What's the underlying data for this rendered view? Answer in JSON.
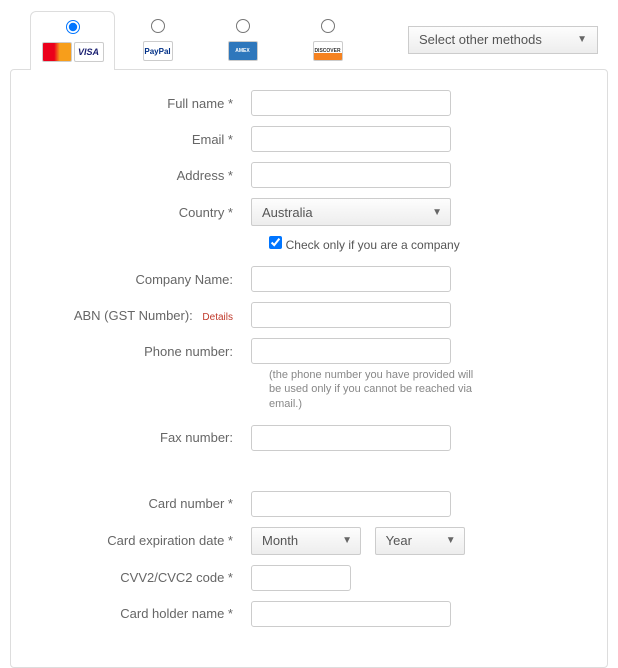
{
  "tabs": {
    "otherLabel": "Select other methods"
  },
  "labels": {
    "fullName": "Full name *",
    "email": "Email *",
    "address": "Address *",
    "country": "Country *",
    "companyCheck": "Check only if you are a company",
    "companyName": "Company Name:",
    "abn": "ABN (GST Number):",
    "details": "Details",
    "phone": "Phone number:",
    "phoneNote": "(the phone number you have provided will be used only if you cannot be reached via email.)",
    "fax": "Fax number:",
    "cardNumber": "Card number *",
    "cardExp": "Card expiration date *",
    "cvv": "CVV2/CVC2 code *",
    "cardHolder": "Card holder name *"
  },
  "values": {
    "country": "Australia",
    "month": "Month",
    "year": "Year",
    "companyChecked": true
  }
}
